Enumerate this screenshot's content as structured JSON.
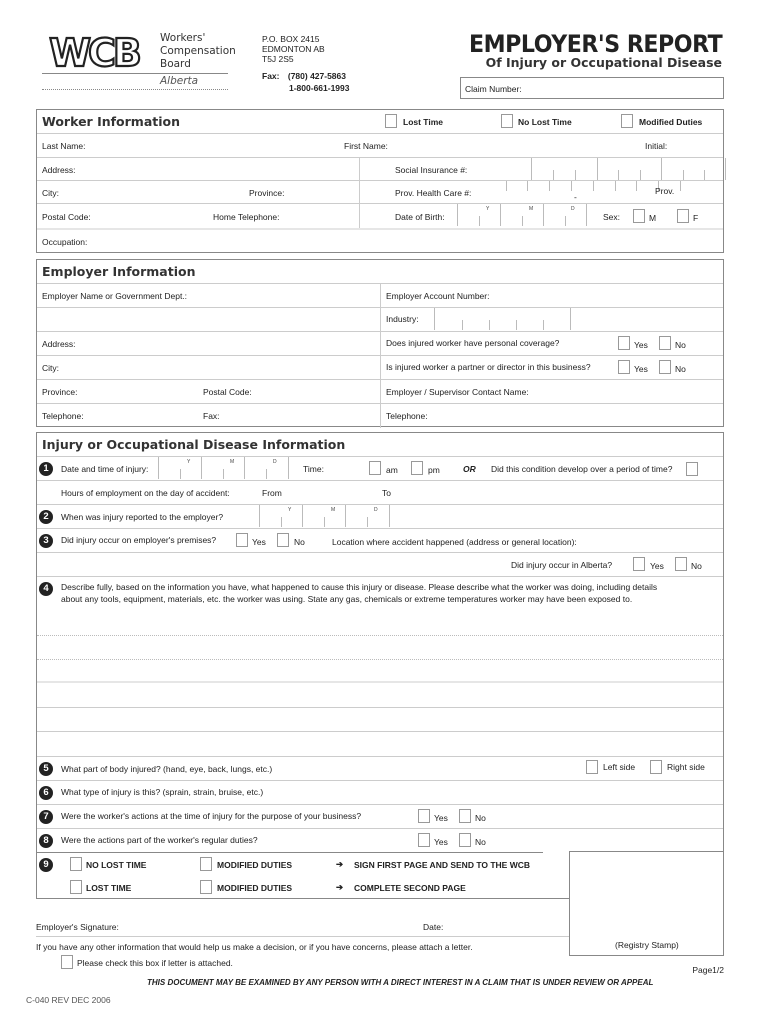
{
  "header": {
    "logo_text": "WCB",
    "org_lines": [
      "Workers'",
      "Compensation",
      "Board"
    ],
    "org_region": "Alberta",
    "address_lines": [
      "P.O. BOX 2415",
      "EDMONTON  AB",
      "T5J 2S5"
    ],
    "fax_label": "Fax:",
    "fax_number": "(780) 427-5863",
    "toll_free": "1-800-661-1993",
    "title": "EMPLOYER'S REPORT",
    "subtitle": "Of Injury or Occupational Disease",
    "claim_number_label": "Claim Number:",
    "claim_number_value": ""
  },
  "worker": {
    "title": "Worker Information",
    "lost_time": "Lost Time",
    "no_lost_time": "No Lost Time",
    "modified_duties": "Modified Duties",
    "last_name": "Last Name:",
    "first_name": "First Name:",
    "initial": "Initial:",
    "address": "Address:",
    "sin": "Social Insurance #:",
    "city": "City:",
    "province": "Province:",
    "health_care": "Prov. Health Care #:",
    "health_dash": "-",
    "prov": "Prov.",
    "postal_code": "Postal Code:",
    "home_telephone": "Home Telephone:",
    "dob": "Date of Birth:",
    "y": "Y",
    "m": "M",
    "d": "D",
    "sex": "Sex:",
    "male": "M",
    "female": "F",
    "occupation": "Occupation:"
  },
  "employer": {
    "title": "Employer Information",
    "name": "Employer Name or Government Dept.:",
    "account_number": "Employer Account Number:",
    "industry": "Industry:",
    "address": "Address:",
    "personal_coverage": "Does injured worker have personal coverage?",
    "city": "City:",
    "partner_director": "Is injured worker a partner or director in this business?",
    "yes": "Yes",
    "no": "No",
    "province": "Province:",
    "postal_code": "Postal Code:",
    "contact_name": "Employer / Supervisor Contact Name:",
    "telephone": "Telephone:",
    "fax": "Fax:",
    "contact_telephone": "Telephone:"
  },
  "injury": {
    "title": "Injury or Occupational Disease Information",
    "q1": {
      "num": "1",
      "label": "Date and time of injury:",
      "time": "Time:",
      "am": "am",
      "pm": "pm",
      "or": "OR",
      "period": "Did this condition develop over a period of time?"
    },
    "hours": {
      "label": "Hours of employment on the day of accident:",
      "from": "From",
      "to": "To"
    },
    "q2": {
      "num": "2",
      "label": "When was injury reported to the employer?"
    },
    "q3": {
      "num": "3",
      "label": "Did injury occur on employer's premises?",
      "yes": "Yes",
      "no": "No",
      "location": "Location where accident happened (address or general location):"
    },
    "alberta": {
      "label": "Did injury occur in Alberta?",
      "yes": "Yes",
      "no": "No"
    },
    "q4": {
      "num": "4",
      "label": "Describe fully, based on the information you have, what happened to cause this injury or disease. Please describe what the worker was doing, including details about any tools, equipment, materials, etc. the worker was using. State any gas, chemicals or extreme temperatures worker may have been exposed to."
    },
    "q5": {
      "num": "5",
      "label": "What part of body injured?  (hand, eye, back, lungs, etc.)",
      "left": "Left side",
      "right": "Right side"
    },
    "q6": {
      "num": "6",
      "label": "What type of injury is this?  (sprain, strain, bruise, etc.)"
    },
    "q7": {
      "num": "7",
      "label": "Were the worker's actions at the time of injury for the purpose of your business?",
      "yes": "Yes",
      "no": "No"
    },
    "q8": {
      "num": "8",
      "label": "Were the actions part of the worker's regular duties?",
      "yes": "Yes",
      "no": "No"
    },
    "q9": {
      "num": "9",
      "rows": [
        {
          "status": "NO LOST TIME",
          "modified": "MODIFIED DUTIES",
          "action": "SIGN FIRST PAGE AND SEND TO THE WCB"
        },
        {
          "status": "LOST TIME",
          "modified": "MODIFIED DUTIES",
          "action": "COMPLETE SECOND PAGE"
        }
      ],
      "arrow": "➔"
    }
  },
  "footer": {
    "signature": "Employer's Signature:",
    "date": "Date:",
    "registry_stamp": "(Registry Stamp)",
    "other_info": "If you have any other information that would help us make a decision, or if you have concerns, please attach a letter.",
    "letter_attached": "Please check this box if letter is attached.",
    "page": "Page1/2",
    "notice": "THIS DOCUMENT MAY BE EXAMINED BY ANY PERSON WITH A DIRECT INTEREST IN A CLAIM THAT IS UNDER REVIEW OR APPEAL",
    "form_code": "C-040 REV DEC 2006"
  }
}
